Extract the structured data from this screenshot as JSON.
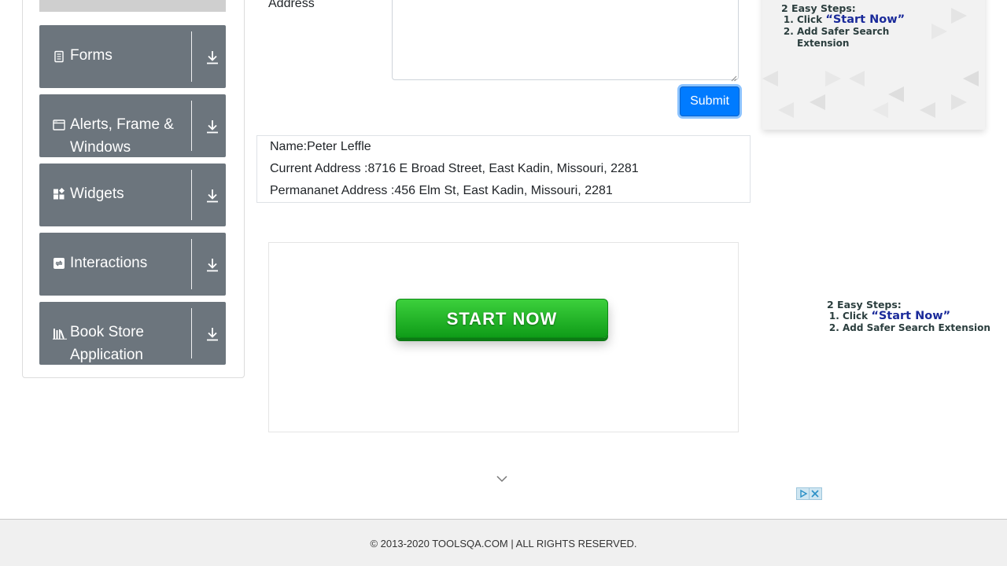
{
  "sidebar": {
    "groups": [
      {
        "label": "Forms",
        "icon": "form-icon"
      },
      {
        "label": "Alerts, Frame & Windows",
        "icon": "window-icon"
      },
      {
        "label": "Widgets",
        "icon": "widgets-icon"
      },
      {
        "label": "Interactions",
        "icon": "interactions-icon"
      },
      {
        "label": "Book Store Application",
        "icon": "books-icon"
      }
    ]
  },
  "form": {
    "address_label": "Address",
    "submit_label": "Submit"
  },
  "output": {
    "name": "Name:Peter Leffle",
    "current_address": "Current Address :8716 E Broad Street, East Kadin, Missouri, 2281",
    "permanent_address": "Permananet Address :456 Elm St, East Kadin, Missouri, 2281"
  },
  "ads": {
    "start_now": "START NOW",
    "steps_title": "2 Easy Steps:",
    "step1_prefix": "Click",
    "step1_highlight": "“Start Now”",
    "step2": "Add Safer Search Extension"
  },
  "footer": {
    "text": "© 2013-2020 TOOLSQA.COM | ALL RIGHTS RESERVED."
  },
  "colors": {
    "sidebar_group_bg": "#6c757d",
    "submit_bg": "#007bff",
    "start_green": "#1aae24"
  }
}
